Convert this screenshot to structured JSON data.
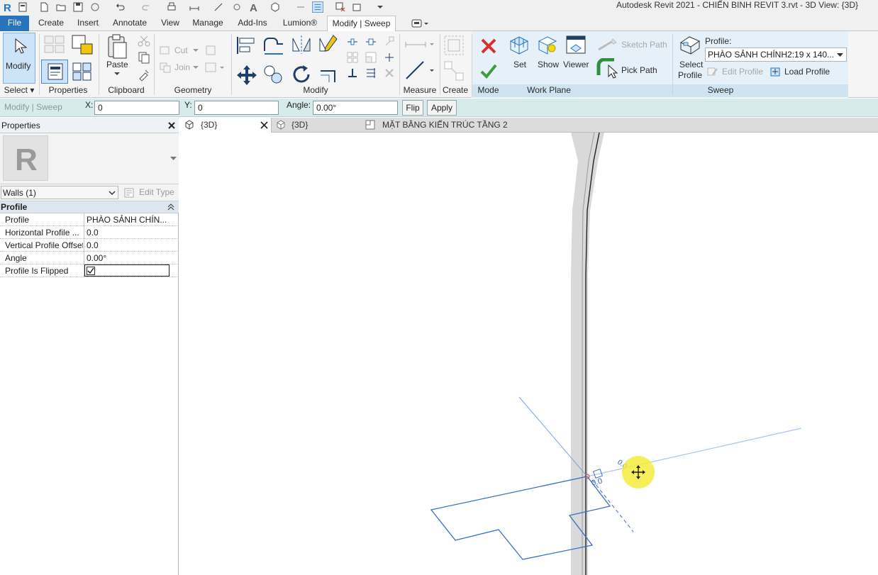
{
  "window": {
    "title": "Autodesk Revit 2021 - CHIẾN BINH REVIT 3.rvt - 3D View: {3D}"
  },
  "ribbon_tabs": [
    {
      "label": "File",
      "active": false
    },
    {
      "label": "Create",
      "active": false
    },
    {
      "label": "Insert",
      "active": false
    },
    {
      "label": "Annotate",
      "active": false
    },
    {
      "label": "View",
      "active": false
    },
    {
      "label": "Manage",
      "active": false
    },
    {
      "label": "Add-Ins",
      "active": false
    },
    {
      "label": "Lumion®",
      "active": false
    },
    {
      "label": "Modify | Sweep",
      "active": true
    }
  ],
  "ribbon": {
    "select": {
      "modify_label": "Modify",
      "panel": "Select"
    },
    "properties": {
      "panel": "Properties"
    },
    "clipboard": {
      "paste_label": "Paste",
      "panel": "Clipboard"
    },
    "geometry": {
      "cut_label": "Cut",
      "join_label": "Join",
      "panel": "Geometry"
    },
    "modify": {
      "panel": "Modify"
    },
    "measure": {
      "panel": "Measure"
    },
    "create": {
      "panel": "Create"
    },
    "mode": {
      "panel": "Mode"
    },
    "work_plane": {
      "set_label": "Set",
      "show_label": "Show",
      "viewer_label": "Viewer",
      "panel": "Work Plane"
    },
    "sweep": {
      "sketch_path_label": "Sketch Path",
      "pick_path_label": "Pick Path",
      "select_profile_label_1": "Select",
      "select_profile_label_2": "Profile",
      "profile_caption": "Profile:",
      "profile_value": "PHÀO SẢNH CHÍNH2:19 x 140...",
      "edit_profile_label": "Edit Profile",
      "load_profile_label": "Load Profile",
      "panel": "Sweep"
    }
  },
  "options_bar": {
    "context": "Modify | Sweep",
    "x_label": "X:",
    "x_value": "0",
    "y_label": "Y:",
    "y_value": "0",
    "angle_label": "Angle:",
    "angle_value": "0.00°",
    "flip_label": "Flip",
    "apply_label": "Apply"
  },
  "properties": {
    "title": "Properties",
    "filter": "Walls (1)",
    "edit_type": "Edit Type",
    "group": "Profile",
    "rows": [
      {
        "name": "Profile",
        "value": "PHÀO SẢNH CHÍN..."
      },
      {
        "name": "Horizontal Profile ...",
        "value": "0.0"
      },
      {
        "name": "Vertical Profile Offset",
        "value": "0.0"
      },
      {
        "name": "Angle",
        "value": "0.00°"
      },
      {
        "name": "Profile Is Flipped",
        "value": "",
        "checked": true
      }
    ]
  },
  "view_tabs": [
    {
      "label": "{3D}",
      "active": true
    },
    {
      "label": "{3D}",
      "active": false
    },
    {
      "label": "MẶT BẰNG KIẾN TRÚC TẦNG 2",
      "active": false
    }
  ],
  "viewport": {
    "dim_a": "0.0",
    "dim_b": "0.0"
  },
  "colors": {
    "accent": "#2774bd",
    "sketch_line": "#3a6fc4",
    "options_bar": "#d6ebea"
  }
}
